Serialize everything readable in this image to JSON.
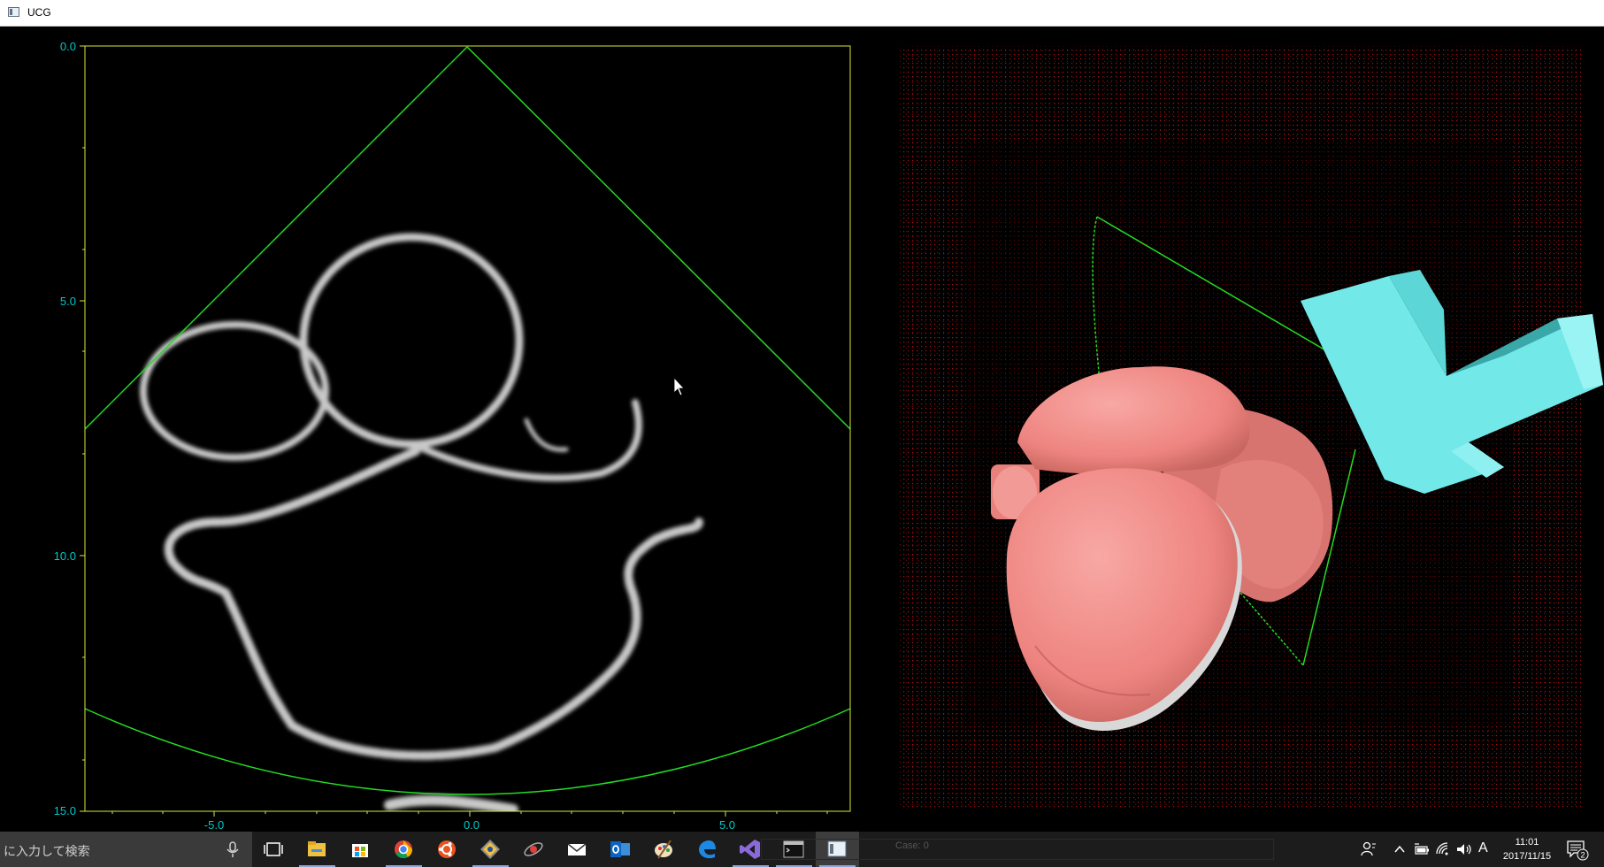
{
  "window": {
    "title": "UCG"
  },
  "ultrasound_view": {
    "y_ticks": [
      "0.0",
      "5.0",
      "10.0",
      "15.0"
    ],
    "x_ticks": [
      "-5.0",
      "0.0",
      "5.0"
    ],
    "colors": {
      "axis_frame": "#d8e83c",
      "axis_labels": "#00c8c8",
      "sector": "#22dd22",
      "echo": "#c8c8c8"
    }
  },
  "view_3d": {
    "colors": {
      "point_cloud": "#e01818",
      "heart_mesh": "#f08a86",
      "probe": "#72e8e8",
      "plane": "#22dd22"
    }
  },
  "taskbar": {
    "search_placeholder": "に入力して検索",
    "status_text": "Case: 0",
    "clock_time": "11:01",
    "clock_date": "2017/11/15",
    "ime_indicator": "A",
    "notification_count": "2",
    "apps": [
      {
        "name": "task-view-icon"
      },
      {
        "name": "file-explorer-icon"
      },
      {
        "name": "store-icon"
      },
      {
        "name": "chrome-icon"
      },
      {
        "name": "ubuntu-icon"
      },
      {
        "name": "git-icon"
      },
      {
        "name": "satellite-icon"
      },
      {
        "name": "mail-icon"
      },
      {
        "name": "outlook-icon"
      },
      {
        "name": "paint-icon"
      },
      {
        "name": "edge-icon"
      },
      {
        "name": "visual-studio-icon"
      },
      {
        "name": "terminal-icon"
      },
      {
        "name": "ucg-app-icon"
      }
    ]
  }
}
